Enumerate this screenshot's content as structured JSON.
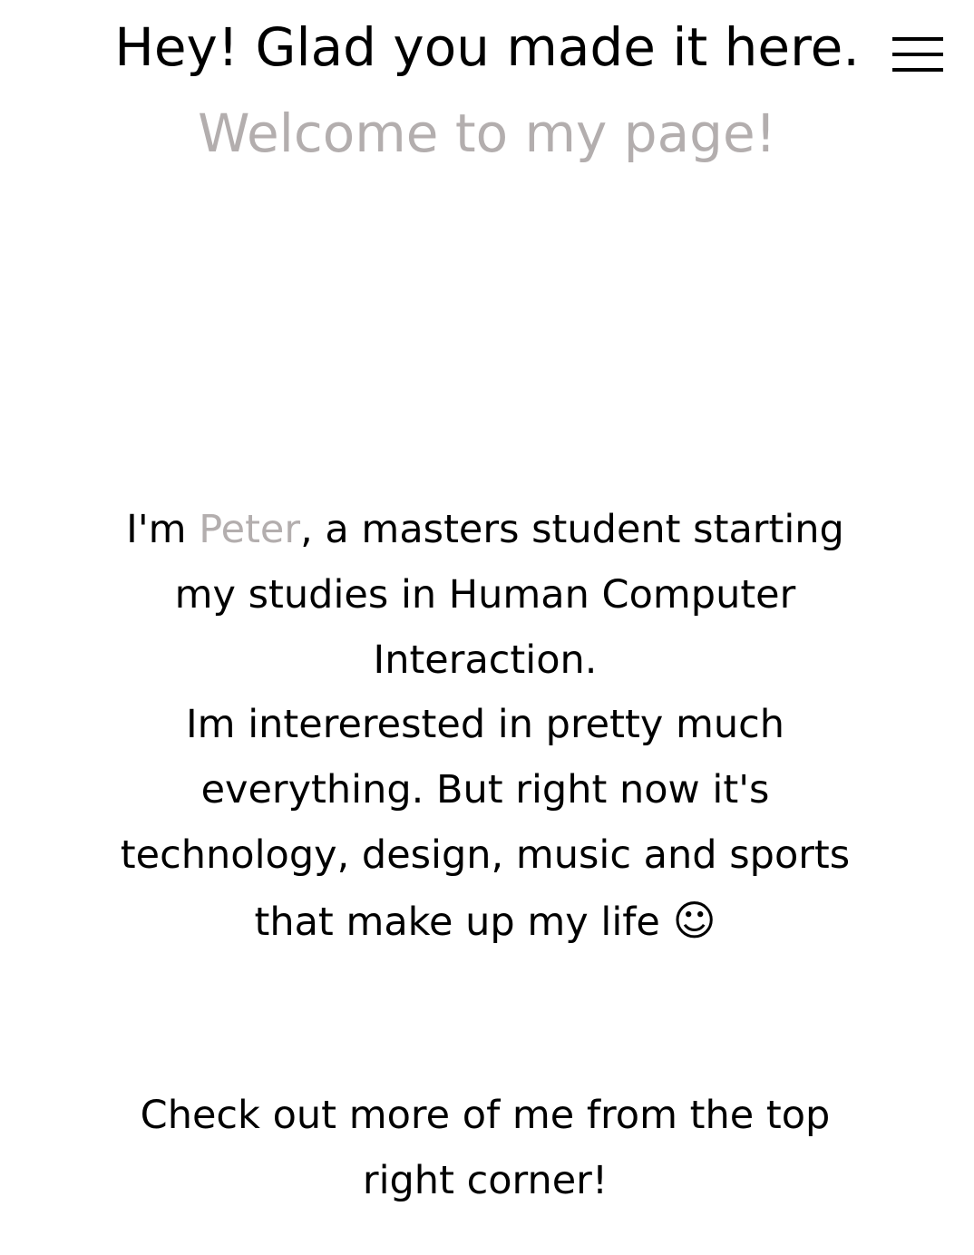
{
  "header": {
    "title": "Hey! Glad you made it here.",
    "subtitle": "Welcome to my page!",
    "menu_icon": "hamburger-menu-icon"
  },
  "intro": {
    "prefix": "I'm ",
    "name": "Peter",
    "rest": ", a masters student starting my studies in Human Computer Interaction."
  },
  "interests": {
    "text": "Im intererested in pretty much everything. But right now it's technology, design, music and sports that make up my life ",
    "smiley": "☺"
  },
  "cta": {
    "text": "Check out more of me from the top right corner!"
  },
  "colors": {
    "text": "#000000",
    "accent_gray": "#b3aeae",
    "background": "#ffffff"
  }
}
